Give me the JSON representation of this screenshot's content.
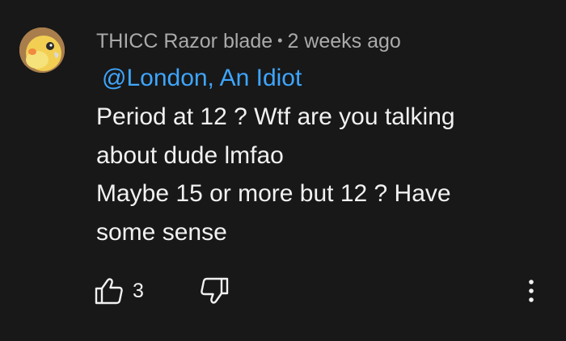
{
  "comment": {
    "author": "THICC Razor blade",
    "separator": "•",
    "timestamp": "2 weeks ago",
    "mention": "@London, An Idiot",
    "body_lines": [
      "Period at 12 ? Wtf are you talking",
      "about dude lmfao",
      "Maybe 15 or more but 12 ? Have",
      "some sense"
    ],
    "like_count": "3",
    "icons": {
      "avatar": "bird-avatar",
      "like": "thumbs-up-icon",
      "dislike": "thumbs-down-icon",
      "more": "more-vertical-icon"
    },
    "colors": {
      "background": "#181818",
      "text": "#f1f1f1",
      "meta": "#aaaaaa",
      "mention": "#3ea6ff"
    }
  }
}
